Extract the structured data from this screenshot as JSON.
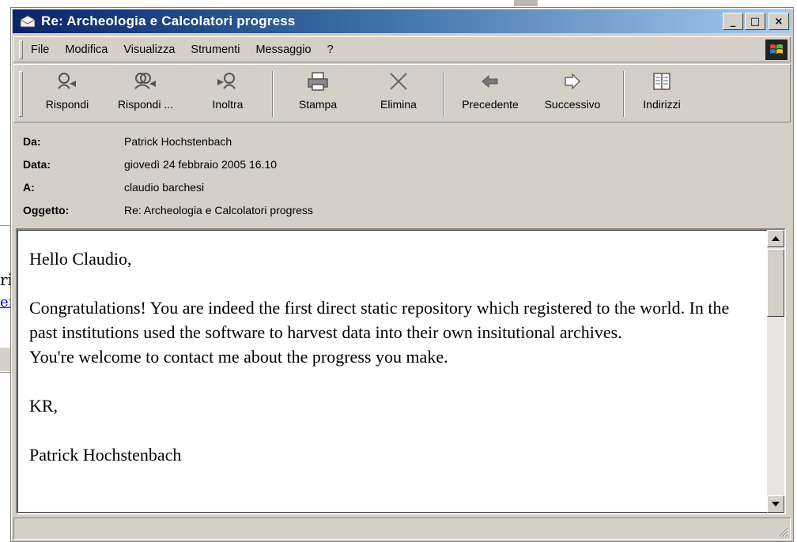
{
  "window": {
    "title": "Re: Archeologia e Calcolatori progress",
    "minimize_label": "_",
    "maximize_label": "□",
    "close_label": "×"
  },
  "menu": {
    "items": [
      "File",
      "Modifica",
      "Visualizza",
      "Strumenti",
      "Messaggio",
      "?"
    ]
  },
  "toolbar": {
    "buttons": [
      {
        "label": "Rispondi",
        "icon": "reply-icon"
      },
      {
        "label": "Rispondi ...",
        "icon": "reply-all-icon"
      },
      {
        "label": "Inoltra",
        "icon": "forward-icon"
      },
      {
        "label": "Stampa",
        "icon": "print-icon"
      },
      {
        "label": "Elimina",
        "icon": "delete-icon"
      },
      {
        "label": "Precedente",
        "icon": "previous-icon"
      },
      {
        "label": "Successivo",
        "icon": "next-icon"
      },
      {
        "label": "Indirizzi",
        "icon": "address-book-icon"
      }
    ]
  },
  "headers": {
    "from_label": "Da:",
    "from_value": "Patrick Hochstenbach",
    "date_label": "Data:",
    "date_value": "giovedì 24 febbraio 2005 16.10",
    "to_label": "A:",
    "to_value": "claudio barchesi",
    "subject_label": "Oggetto:",
    "subject_value": "Re: Archeologia e Calcolatori progress"
  },
  "message": {
    "greeting": "Hello Claudio,",
    "paragraph1": "Congratulations! You are indeed the first direct static repository which registered to the world. In the past institutions used the software to harvest data into their own insitutional archives.",
    "paragraph2": "You're welcome to contact me about the progress you make.",
    "closing": "KR,",
    "signature": "Patrick Hochstenbach"
  },
  "background": {
    "fragment_text": "ri",
    "fragment_link": "er"
  },
  "colors": {
    "titlebar_start": "#0a246a",
    "titlebar_end": "#a6caf0",
    "chrome": "#d4d0c8"
  }
}
